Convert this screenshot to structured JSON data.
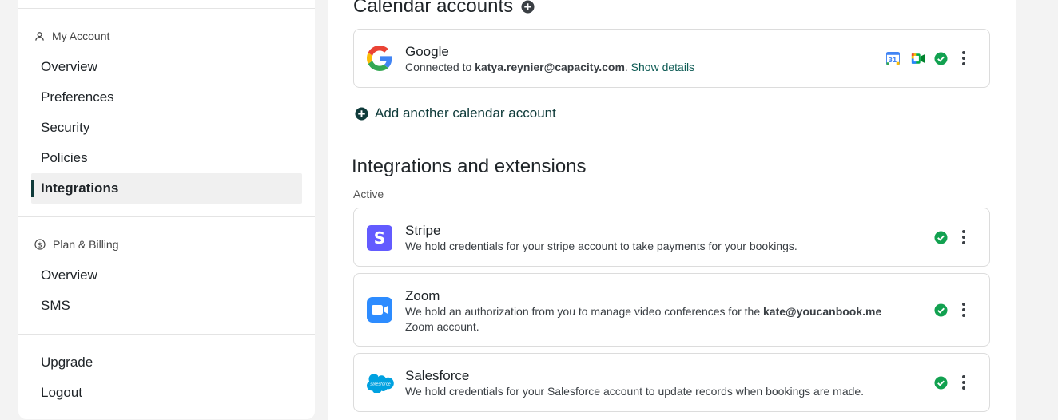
{
  "sidebar": {
    "account_section": {
      "title": "My Account",
      "items": [
        {
          "label": "Overview"
        },
        {
          "label": "Preferences"
        },
        {
          "label": "Security"
        },
        {
          "label": "Policies"
        },
        {
          "label": "Integrations",
          "active": true
        }
      ]
    },
    "billing_section": {
      "title": "Plan & Billing",
      "items": [
        {
          "label": "Overview"
        },
        {
          "label": "SMS"
        }
      ]
    },
    "bottom_items": [
      {
        "label": "Upgrade"
      },
      {
        "label": "Logout"
      }
    ]
  },
  "calendar": {
    "heading": "Calendar accounts",
    "accounts": [
      {
        "name": "Google",
        "connected_prefix": "Connected to ",
        "email": "katya.reynier@capacity.com",
        "separator": ".",
        "details_link": "Show details",
        "icons": [
          "google-calendar-icon",
          "google-meet-icon",
          "check-icon",
          "more-icon"
        ]
      }
    ],
    "add_link": "Add another calendar account"
  },
  "integrations": {
    "heading": "Integrations and extensions",
    "status_label": "Active",
    "items": [
      {
        "name": "Stripe",
        "description": "We hold credentials for your stripe account to take payments for your bookings."
      },
      {
        "name": "Zoom",
        "description_prefix": "We hold an authorization from you to manage video conferences for the ",
        "description_bold": "kate@youcanbook.me",
        "description_suffix": "Zoom account."
      },
      {
        "name": "Salesforce",
        "description": "We hold credentials for your Salesforce account to update records when bookings are made.",
        "logo_text": "salesforce"
      }
    ]
  },
  "colors": {
    "accent": "#0f3b3a",
    "link": "#0f5c55",
    "success": "#12a150",
    "stripe": "#635bff",
    "zoom": "#2d8cff",
    "salesforce": "#00a1e0"
  }
}
